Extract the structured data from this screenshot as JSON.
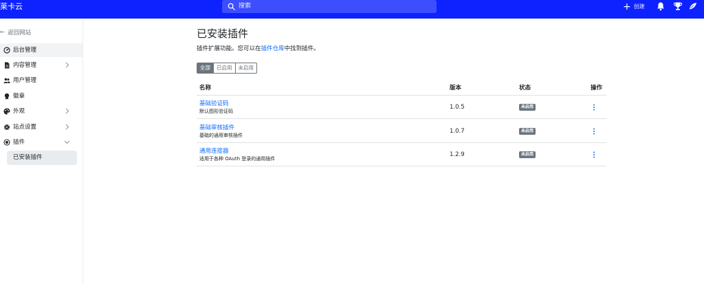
{
  "brand": "莱卡云",
  "search": {
    "placeholder": "搜索"
  },
  "topbar": {
    "create_label": "创建"
  },
  "sidebar": {
    "back_label": "返回网站",
    "items": [
      {
        "label": "后台管理",
        "icon": "dashboard-icon"
      },
      {
        "label": "内容管理",
        "icon": "document-icon"
      },
      {
        "label": "用户管理",
        "icon": "users-icon"
      },
      {
        "label": "徽章",
        "icon": "badge-icon"
      },
      {
        "label": "外观",
        "icon": "palette-icon"
      },
      {
        "label": "站点设置",
        "icon": "gear-icon"
      },
      {
        "label": "插件",
        "icon": "plugin-icon"
      }
    ],
    "sub_item": "已安装插件"
  },
  "main": {
    "title": "已安装插件",
    "desc_prefix": "插件扩展功能。您可以在",
    "desc_link": "插件仓库",
    "desc_suffix": "中找到插件。",
    "filters": [
      "全部",
      "已启用",
      "未启用"
    ]
  },
  "table": {
    "headers": [
      "名称",
      "版本",
      "状态",
      "操作"
    ],
    "rows": [
      {
        "name": "基础验证码",
        "desc": "默认图形验证码",
        "version": "1.0.5",
        "status": "未启用"
      },
      {
        "name": "基础审核插件",
        "desc": "基础的通用审核插件",
        "version": "1.0.7",
        "status": "未启用"
      },
      {
        "name": "通用连接器",
        "desc": "适用于各种 OAuth 登录的通用插件",
        "version": "1.2.9",
        "status": "未启用"
      }
    ]
  },
  "colors": {
    "topbar": "#0d22ff",
    "link": "#0d6efd",
    "badge": "#6c757d"
  }
}
